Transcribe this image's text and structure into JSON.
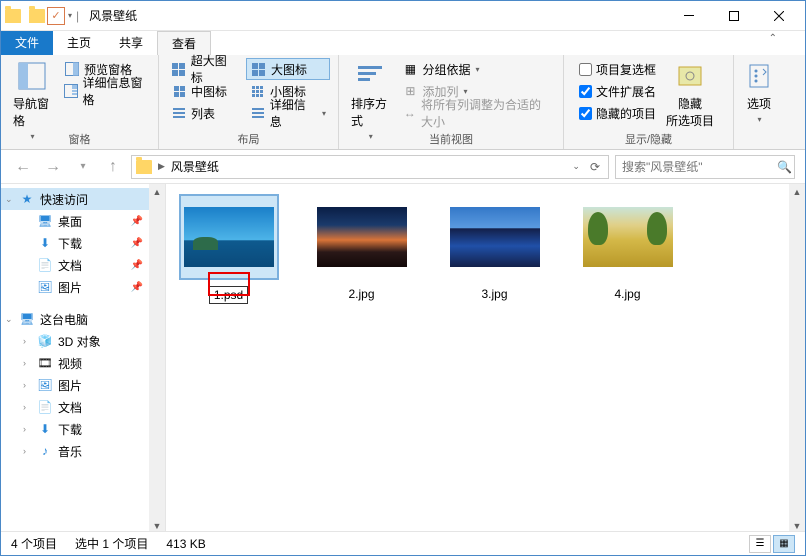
{
  "window": {
    "title": "风景壁纸"
  },
  "tabs": {
    "file": "文件",
    "home": "主页",
    "share": "共享",
    "view": "查看"
  },
  "ribbon": {
    "pane": {
      "navPane": "导航窗格",
      "previewPane": "预览窗格",
      "detailsPane": "详细信息窗格",
      "label": "窗格"
    },
    "layout": {
      "extraLarge": "超大图标",
      "large": "大图标",
      "medium": "中图标",
      "small": "小图标",
      "list": "列表",
      "details": "详细信息",
      "label": "布局"
    },
    "view": {
      "sortBy": "排序方式",
      "groupBy": "分组依据",
      "addColumns": "添加列",
      "sizeAll": "将所有列调整为合适的大小",
      "label": "当前视图"
    },
    "showHide": {
      "itemCheck": "项目复选框",
      "fileExt": "文件扩展名",
      "hidden": "隐藏的项目",
      "hideSel": "隐藏\n所选项目",
      "label": "显示/隐藏"
    },
    "options": "选项"
  },
  "checks": {
    "itemCheck": false,
    "fileExt": true,
    "hidden": true
  },
  "address": {
    "path": "风景壁纸"
  },
  "search": {
    "placeholder": "搜索\"风景壁纸\""
  },
  "sidebar": {
    "quickAccess": "快速访问",
    "desktop": "桌面",
    "downloads": "下载",
    "documents": "文档",
    "pictures": "图片",
    "thisPC": "这台电脑",
    "objects3d": "3D 对象",
    "videos": "视频",
    "picturesPC": "图片",
    "documentsPC": "文档",
    "downloadsPC": "下载",
    "music": "音乐"
  },
  "files": [
    {
      "name": "1.psd"
    },
    {
      "name": "2.jpg"
    },
    {
      "name": "3.jpg"
    },
    {
      "name": "4.jpg"
    }
  ],
  "status": {
    "count": "4 个项目",
    "selected": "选中 1 个项目",
    "size": "413 KB"
  }
}
